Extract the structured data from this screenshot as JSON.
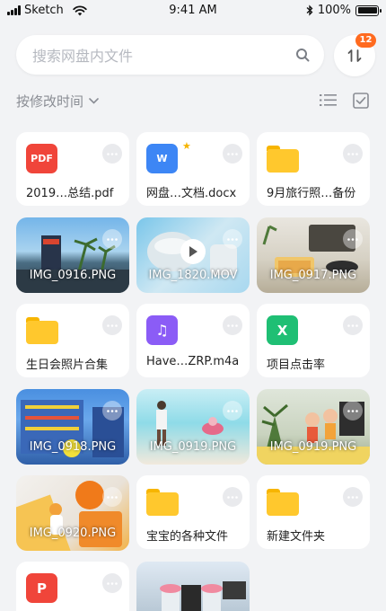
{
  "status_bar": {
    "carrier": "Sketch",
    "time": "9:41 AM",
    "battery": "100%",
    "battery_level": 1.0
  },
  "search": {
    "placeholder": "搜索网盘内文件"
  },
  "sort_button": {
    "badge": "12"
  },
  "sort_row": {
    "label": "按修改时间"
  },
  "grid": [
    {
      "name": "2019…总结.pdf",
      "type": "pdf",
      "icon_text": "PDF",
      "color": "#f0453a"
    },
    {
      "name": "网盘…文档.docx",
      "type": "word",
      "icon_text": "W",
      "color": "#3d86f5",
      "starred": true
    },
    {
      "name": "9月旅行照…备份",
      "type": "folder",
      "color": "#ffc82d"
    },
    {
      "name": "IMG_0916.PNG",
      "type": "image"
    },
    {
      "name": "IMG_1820.MOV",
      "type": "video"
    },
    {
      "name": "IMG_0917.PNG",
      "type": "image"
    },
    {
      "name": "生日会照片合集",
      "type": "folder",
      "color": "#ffc82d"
    },
    {
      "name": "Have…ZRP.m4a",
      "type": "audio",
      "icon_text": "♫",
      "color": "#8b5cf6"
    },
    {
      "name": "项目点击率",
      "type": "excel",
      "icon_text": "X",
      "color": "#1fbf74"
    },
    {
      "name": "IMG_0918.PNG",
      "type": "image"
    },
    {
      "name": "IMG_0919.PNG",
      "type": "image"
    },
    {
      "name": "IMG_0919.PNG",
      "type": "image"
    },
    {
      "name": "IMG_0920.PNG",
      "type": "image"
    },
    {
      "name": "宝宝的各种文件",
      "type": "folder",
      "color": "#ffc82d"
    },
    {
      "name": "新建文件夹",
      "type": "folder",
      "color": "#ffc82d"
    },
    {
      "name": "",
      "type": "ppt",
      "icon_text": "P",
      "color": "#f0453a"
    },
    {
      "name": "",
      "type": "image"
    }
  ]
}
